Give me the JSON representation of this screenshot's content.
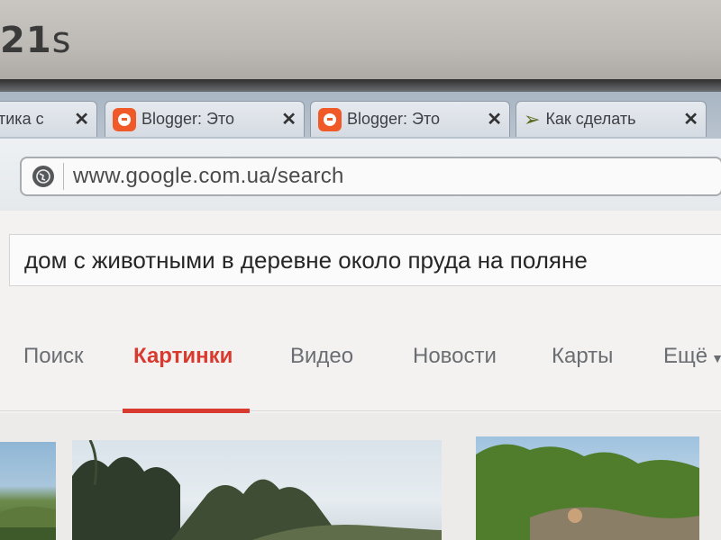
{
  "bezel": {
    "time_prefix": "21",
    "time_suffix": "s"
  },
  "tabs": [
    {
      "title": "стика с",
      "icon": "none"
    },
    {
      "title": "Blogger: Это",
      "icon": "blogger-icon"
    },
    {
      "title": "Blogger: Это",
      "icon": "blogger-icon"
    },
    {
      "title": "Как сделать",
      "icon": "paper-plane-icon"
    }
  ],
  "address_bar": {
    "url_host": "www.google.com.ua",
    "url_path": "/search"
  },
  "search": {
    "query": "дом с животными в деревне около пруда на поляне"
  },
  "nav": {
    "items": [
      "Поиск",
      "Картинки",
      "Видео",
      "Новости",
      "Карты",
      "Ещё"
    ],
    "active": "Картинки"
  },
  "colors": {
    "accent": "#d93a2f",
    "blogger": "#f05a28"
  }
}
